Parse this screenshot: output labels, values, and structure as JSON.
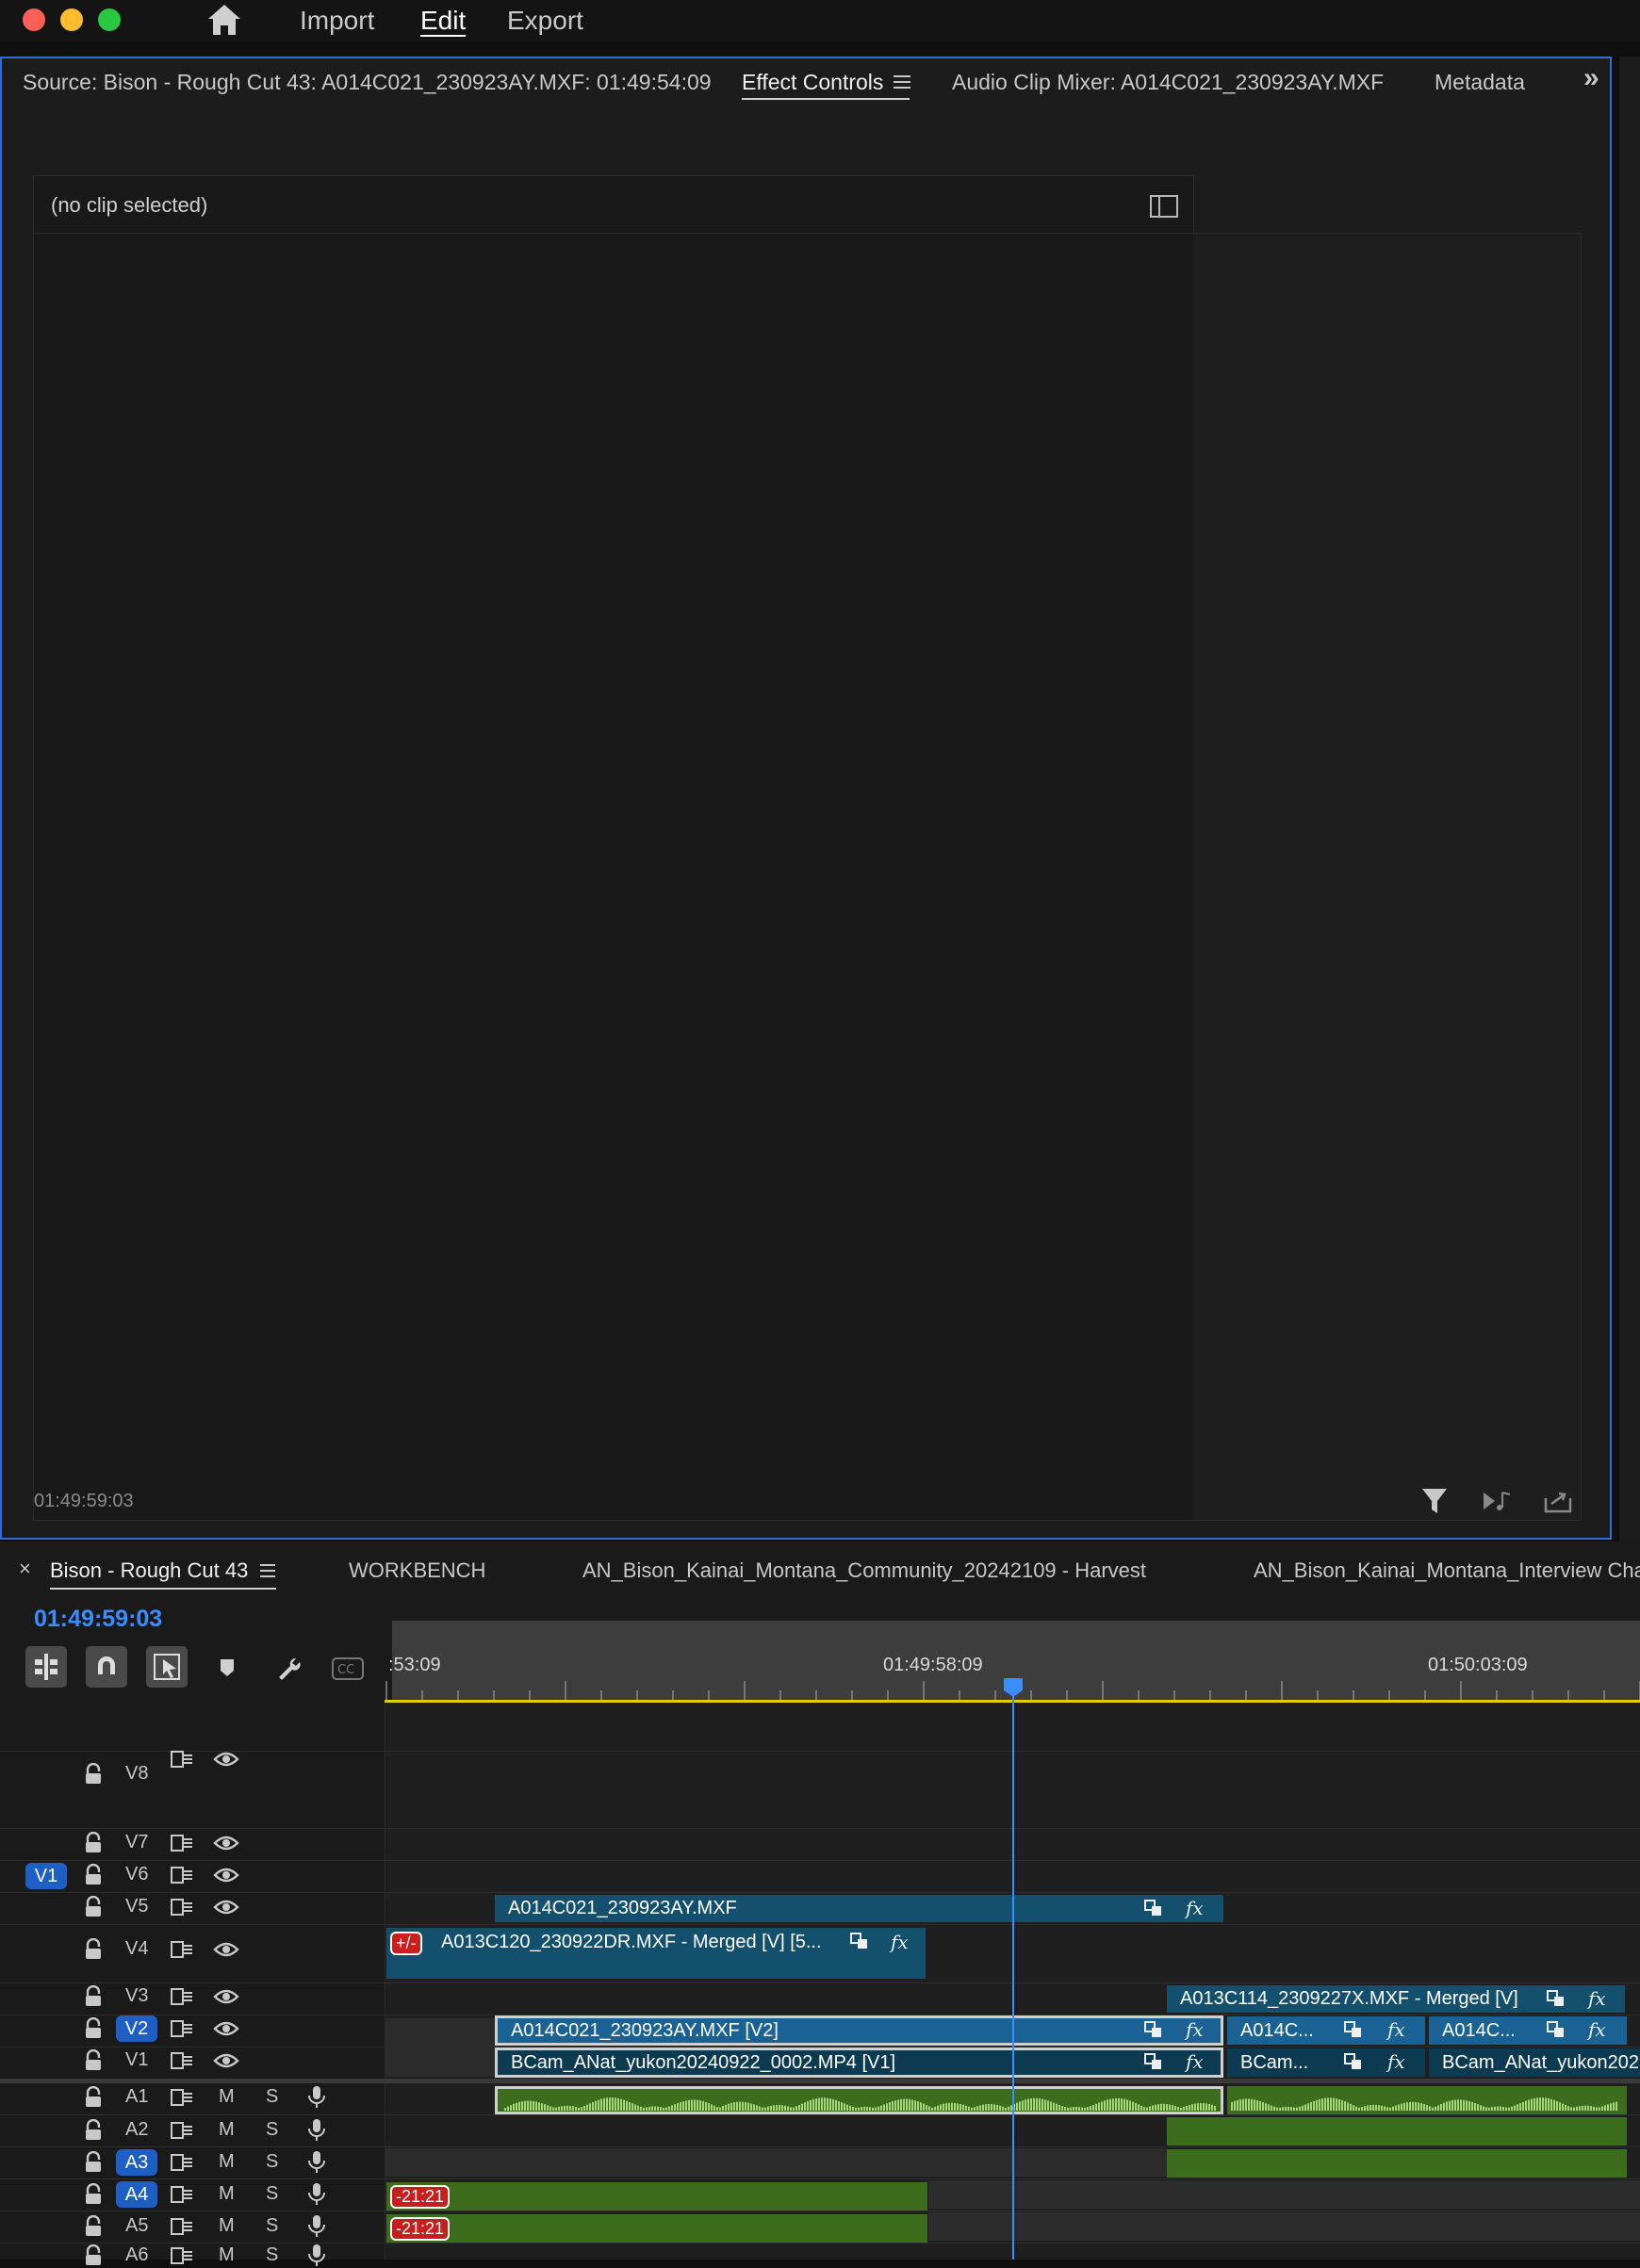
{
  "menu": {
    "import": "Import",
    "edit": "Edit",
    "export": "Export"
  },
  "panel_tabs": {
    "source": "Source: Bison - Rough Cut 43: A014C021_230923AY.MXF: 01:49:54:09",
    "effect_controls": "Effect Controls",
    "audio_mixer": "Audio Clip Mixer: A014C021_230923AY.MXF",
    "metadata": "Metadata",
    "overflow": "»"
  },
  "effect_panel": {
    "no_clip": "(no clip selected)",
    "timecode": "01:49:59:03"
  },
  "timeline": {
    "tabs": {
      "close": "×",
      "sequence": "Bison - Rough Cut 43",
      "workbench": "WORKBENCH",
      "harvest": "AN_Bison_Kainai_Montana_Community_20242109 - Harvest",
      "interview": "AN_Bison_Kainai_Montana_Interview Cha"
    },
    "timecode": "01:49:59:03",
    "ruler": {
      "t1": ":53:09",
      "t2": "01:49:58:09",
      "t3": "01:50:03:09"
    },
    "tracks": {
      "v8": "V8",
      "v7": "V7",
      "v6": "V6",
      "v5": "V5",
      "v4": "V4",
      "v3": "V3",
      "v2": "V2",
      "v1": "V1",
      "a1": "A1",
      "a2": "A2",
      "a3": "A3",
      "a4": "A4",
      "a5": "A5",
      "a6": "A6",
      "source_patch": "V1",
      "mute": "M",
      "solo": "S"
    },
    "clips": {
      "v5": "A014C021_230923AY.MXF",
      "v4": "A013C120_230922DR.MXF - Merged [V] [5...",
      "v3": "A013C114_2309227X.MXF - Merged [V]",
      "v2_main": "A014C021_230923AY.MXF [V2]",
      "v2_b": "A014C...",
      "v2_c": "A014C...",
      "v1_main": "BCam_ANat_yukon20240922_0002.MP4 [V1]",
      "v1_b": "BCam...",
      "v1_c": "BCam_ANat_yukon202",
      "v4_tag": "+/-",
      "a4_tag": "-21:21",
      "a5_tag": "-21:21",
      "fx": "fx"
    }
  },
  "colors": {
    "accent": "#2d6fd6",
    "clip_blue": "#13506e",
    "audio_green": "#3c6d1c",
    "playhead": "#3a8dff",
    "work_area": "#e0d000"
  }
}
